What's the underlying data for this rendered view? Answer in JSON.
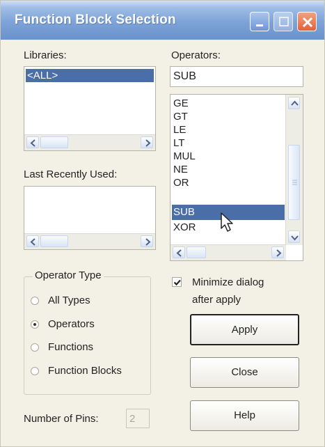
{
  "window": {
    "title": "Function Block Selection"
  },
  "titlebar_buttons": {
    "minimize_icon": "minimize-icon",
    "maximize_icon": "maximize-icon",
    "close_icon": "close-icon"
  },
  "libraries": {
    "label": "Libraries:",
    "items": [
      "<ALL>"
    ],
    "selected": "<ALL>"
  },
  "operators": {
    "label": "Operators:",
    "filter_value": "SUB",
    "items": [
      "GE",
      "GT",
      "LE",
      "LT",
      "MUL",
      "NE",
      "OR",
      "SUB",
      "XOR"
    ],
    "selected": "SUB"
  },
  "last_recently_used": {
    "label": "Last Recently Used:",
    "items": []
  },
  "operator_type": {
    "label": "Operator Type",
    "options": [
      "All Types",
      "Operators",
      "Functions",
      "Function Blocks"
    ],
    "selected": "Operators"
  },
  "minimize_dialog": {
    "label_line1": "Minimize dialog",
    "label_line2": "after apply",
    "checked": true
  },
  "buttons": {
    "apply": "Apply",
    "close": "Close",
    "help": "Help"
  },
  "number_of_pins": {
    "label": "Number of Pins:",
    "value": "2"
  },
  "colors": {
    "selection": "#4a6ea8",
    "title_bar": "#7da3d8",
    "close_button": "#e0613d"
  }
}
